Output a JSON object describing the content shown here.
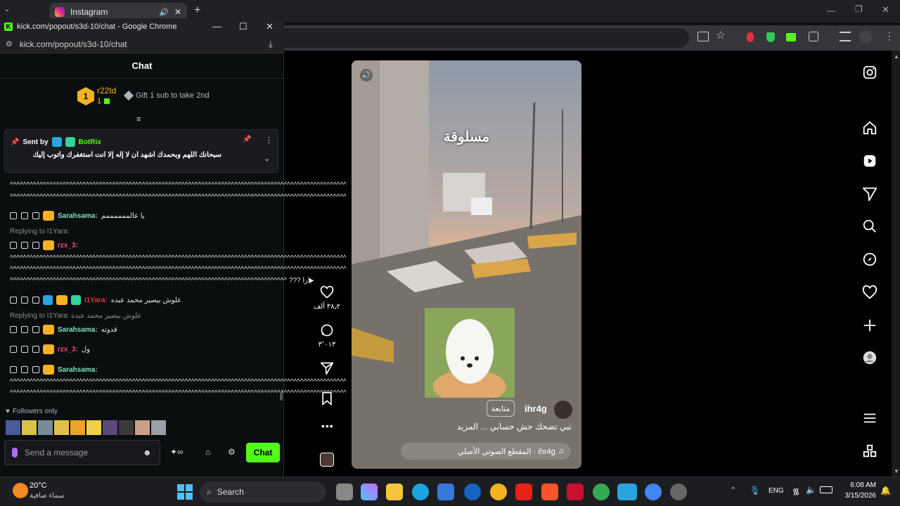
{
  "background_tab": {
    "title": "Instagram"
  },
  "popup": {
    "window_title": "kick.com/popout/s3d-10/chat - Google Chrome",
    "url": "kick.com/popout/s3d-10/chat"
  },
  "chat": {
    "header": "Chat",
    "leader": {
      "rank": "1",
      "name": "r22td",
      "count": "1",
      "gift_text": "Gift 1 sub to take 2nd"
    },
    "pinned": {
      "sent_by_label": "Sent by",
      "sender": "BotRix",
      "text": "سبحانك اللهم وبحمدك أشهد أن لا إله إلا أنت أستغفرك وأتوب إليك"
    },
    "lines": {
      "l1": "^^^^^^^^^^^^^^^^^^^^^^^^^^^^^^^^^^^^^^^^^^^^^^^^^^^^^^^^^^^^^^^^^^^^^^^^^^^^^^^^^^^^^^^^^^^^^^^^^^^^^^",
      "l2": "^^^^^^^^^^^^^^^^^^^^^^^^^^^^^^^^^^^^^^^^^^^^^^^^^^^^^^^^^^^^^^^^^^^^^^^^^^^^^^^^^^^^^^^^^^^^^^^^^^^^^^",
      "l3": "^^^^^^^^^^^^^^^^^^^^^^^^^^^^^^^^^^^^^^^^^^^^^^^^^^^^^^^^^^^^^^^^^^^^^^^^^^^^^^^^^^^^^^^^^^^^^^^^^^^^^^",
      "l4": "^^^^^^^^^^^^^^^^^^^^^^^^^^^^^^^^^^^^^^^^^^^^^^^^^^^^^^^^^^^^^^^^^^^^^^^^^^^^^^^^^^^^^^^^^^^^^^^^^^^^^^",
      "l5": "^^^^^^^^^^^^^^^^^^^^^^^^^^^^^^^^^^^^^^^^^^^^^^^^^^^^^^^^^^^^^^^^^^^^^^^^^^^^^^^^^^^^ ??? يارا",
      "l6": "^^^^^^^^^^^^^^^^^^^^^^^^^^^^^^^^^^^^^^^^^^^^^^^^^^^^^^^^^^^^^^^^^^^^^^^^^^^^^^^^^^^^^^^^^^^^^^^^^^^^^^",
      "l7": "^^^^^^^^^^^^^^^^^^^^^^^^^^^^^^^^^^^^^^^^^^^^^^^^^^^^^^^^^^^^^^^^^^^^^^^^^^^^^^^^^^^^^^^^^^^^^^^^^^^^^^"
    },
    "messages": [
      {
        "user": "Sarahsama:",
        "text": "يا عالممممممم"
      },
      {
        "user": "rzx_3:",
        "text": ""
      },
      {
        "user": "I1Yara:",
        "text": "علوش بيصير محمد عبده"
      },
      {
        "user": "Sarahsama:",
        "text": "قدوته"
      },
      {
        "user": "rzx_3:",
        "text": "ول"
      },
      {
        "user": "Sarahsama:",
        "text": ""
      }
    ],
    "replies": {
      "r1": "Replying to I1Yara:",
      "r2": "Replying to I1Yara: علوش بيصير محمد عبده"
    },
    "followers_only": "Followers only",
    "input_placeholder": "Send a message",
    "send_button": "Chat"
  },
  "reel": {
    "overlay_text": "مسلوقة",
    "username": "ihr4g",
    "follow_button": "متابعة",
    "caption": "تبي تضحك خش حسابي ... المزيد",
    "audio": "ihr4g · المقطع الصوتي الأصلي",
    "likes": "٣٨٫٢ ألف",
    "comments": "٣٬٠١٣"
  },
  "taskbar": {
    "weather_temp": "20°C",
    "weather_desc": "سماء صافية",
    "search_label": "Search",
    "lang": "ENG",
    "time": "6:08 AM",
    "date": "3/15/2026"
  }
}
